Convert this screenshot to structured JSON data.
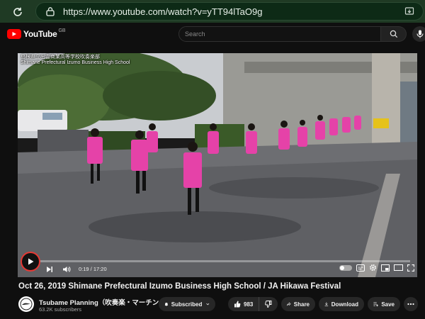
{
  "browser": {
    "url": "https://www.youtube.com/watch?v=yTT94lTaO9g",
    "accent_color": "#1f3a24"
  },
  "header": {
    "logo_text": "YouTube",
    "country_code": "GB",
    "search_placeholder": "Search"
  },
  "player": {
    "overlay_caption_jp": "島根県立出雲商業高等学校吹奏楽部",
    "overlay_caption_en": "Shimane Prefectural Izumo Business High School",
    "time_display": "0:19 / 17:20",
    "progress_fraction": 0.018,
    "progress_color": "#ff0000"
  },
  "video": {
    "title": "Oct 26, 2019 Shimane Prefectural Izumo Business High School / JA Hikawa Festival"
  },
  "channel": {
    "name": "Tsubame Planning（吹奏楽・マーチン...",
    "subscribers": "63.2K subscribers",
    "subscribe_label": "Subscribed"
  },
  "actions": {
    "like_count": "983",
    "share_label": "Share",
    "download_label": "Download",
    "save_label": "Save"
  }
}
